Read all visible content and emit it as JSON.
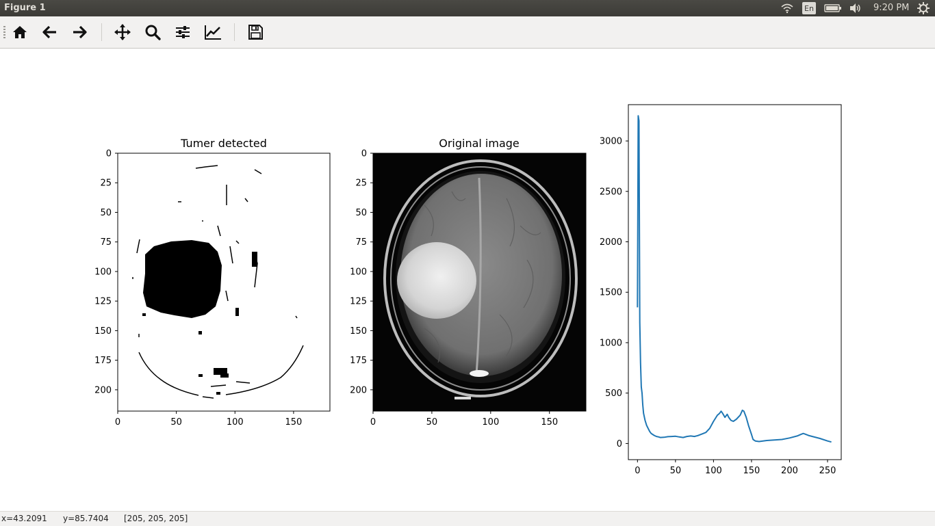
{
  "window": {
    "title": "Figure 1"
  },
  "system_tray": {
    "keyboard_layout": "En",
    "time": "9:20 PM",
    "icons": [
      "wifi-icon",
      "battery-icon",
      "volume-icon",
      "settings-gear-icon"
    ]
  },
  "toolbar": {
    "buttons": [
      {
        "name": "home-button",
        "icon": "home-icon"
      },
      {
        "name": "back-button",
        "icon": "arrow-left-icon"
      },
      {
        "name": "forward-button",
        "icon": "arrow-right-icon"
      },
      {
        "name": "pan-button",
        "icon": "move-arrows-icon"
      },
      {
        "name": "zoom-button",
        "icon": "magnifier-icon"
      },
      {
        "name": "configure-subplots-button",
        "icon": "sliders-icon"
      },
      {
        "name": "edit-axes-button",
        "icon": "line-chart-icon"
      },
      {
        "name": "save-button",
        "icon": "floppy-disk-icon"
      }
    ]
  },
  "status": {
    "x": "x=43.2091",
    "y": "y=85.7404",
    "pixel": "[205, 205, 205]"
  },
  "chart_data": [
    {
      "type": "image",
      "title": "Tumer detected",
      "x_ticks": [
        "0",
        "50",
        "100",
        "150"
      ],
      "y_ticks": [
        "0",
        "25",
        "50",
        "75",
        "100",
        "125",
        "150",
        "175",
        "200"
      ],
      "xlim": [
        0,
        181
      ],
      "ylim": [
        218,
        0
      ],
      "colormap": "binary"
    },
    {
      "type": "image",
      "title": "Original image",
      "x_ticks": [
        "0",
        "50",
        "100",
        "150"
      ],
      "y_ticks": [
        "0",
        "25",
        "50",
        "75",
        "100",
        "125",
        "150",
        "175",
        "200"
      ],
      "xlim": [
        0,
        181
      ],
      "ylim": [
        218,
        0
      ],
      "colormap": "gray"
    },
    {
      "type": "line",
      "title": "",
      "x_ticks": [
        "0",
        "50",
        "100",
        "150",
        "200",
        "250"
      ],
      "y_ticks": [
        "0",
        "500",
        "1000",
        "1500",
        "2000",
        "2500",
        "3000"
      ],
      "xlim": [
        -12,
        268
      ],
      "ylim": [
        -160,
        3360
      ],
      "color": "#1f77b4",
      "series": [
        {
          "x": [
            0,
            1,
            2,
            3,
            4,
            5,
            6,
            7,
            8,
            10,
            12,
            14,
            16,
            18,
            20,
            22,
            25,
            28,
            30,
            35,
            40,
            45,
            50,
            55,
            60,
            65,
            70,
            75,
            80,
            85,
            90,
            95,
            100,
            105,
            108,
            110,
            112,
            115,
            118,
            120,
            123,
            126,
            130,
            135,
            138,
            140,
            143,
            146,
            150,
            152,
            155,
            160,
            165,
            170,
            180,
            190,
            200,
            210,
            215,
            218,
            220,
            225,
            230,
            240,
            250,
            255
          ],
          "y": [
            1350,
            3250,
            3200,
            1200,
            800,
            560,
            500,
            380,
            300,
            230,
            180,
            150,
            120,
            100,
            90,
            80,
            70,
            65,
            60,
            62,
            68,
            70,
            72,
            65,
            60,
            70,
            75,
            70,
            80,
            95,
            110,
            150,
            220,
            280,
            300,
            320,
            300,
            260,
            290,
            260,
            230,
            220,
            240,
            280,
            330,
            320,
            260,
            180,
            90,
            40,
            25,
            20,
            25,
            30,
            35,
            40,
            55,
            75,
            90,
            100,
            95,
            80,
            70,
            50,
            25,
            15
          ]
        }
      ]
    }
  ]
}
